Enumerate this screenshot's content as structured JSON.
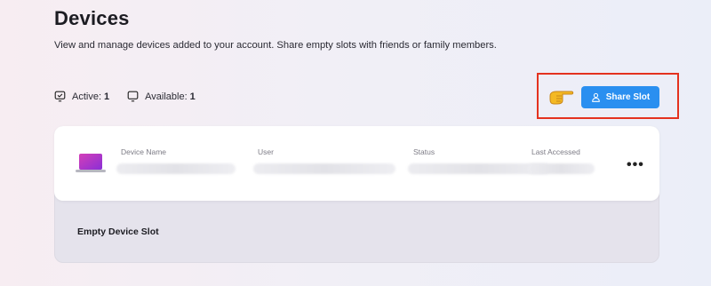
{
  "page": {
    "title": "Devices",
    "subtitle": "View and manage devices added to your account. Share empty slots with friends or family members."
  },
  "stats": {
    "active_label": "Active:",
    "active_count": "1",
    "available_label": "Available:",
    "available_count": "1"
  },
  "share_button": {
    "label": "Share Slot"
  },
  "device_table": {
    "columns": [
      "Device Name",
      "User",
      "Status",
      "Last Accessed"
    ]
  },
  "empty_slot": {
    "label": "Empty Device Slot"
  },
  "colors": {
    "accent": "#2a8ff0",
    "highlight": "#e4321f"
  },
  "icons": [
    "monitor-check-icon",
    "monitor-icon",
    "pointing-hand-icon",
    "user-icon",
    "laptop-icon",
    "more-options-icon"
  ]
}
